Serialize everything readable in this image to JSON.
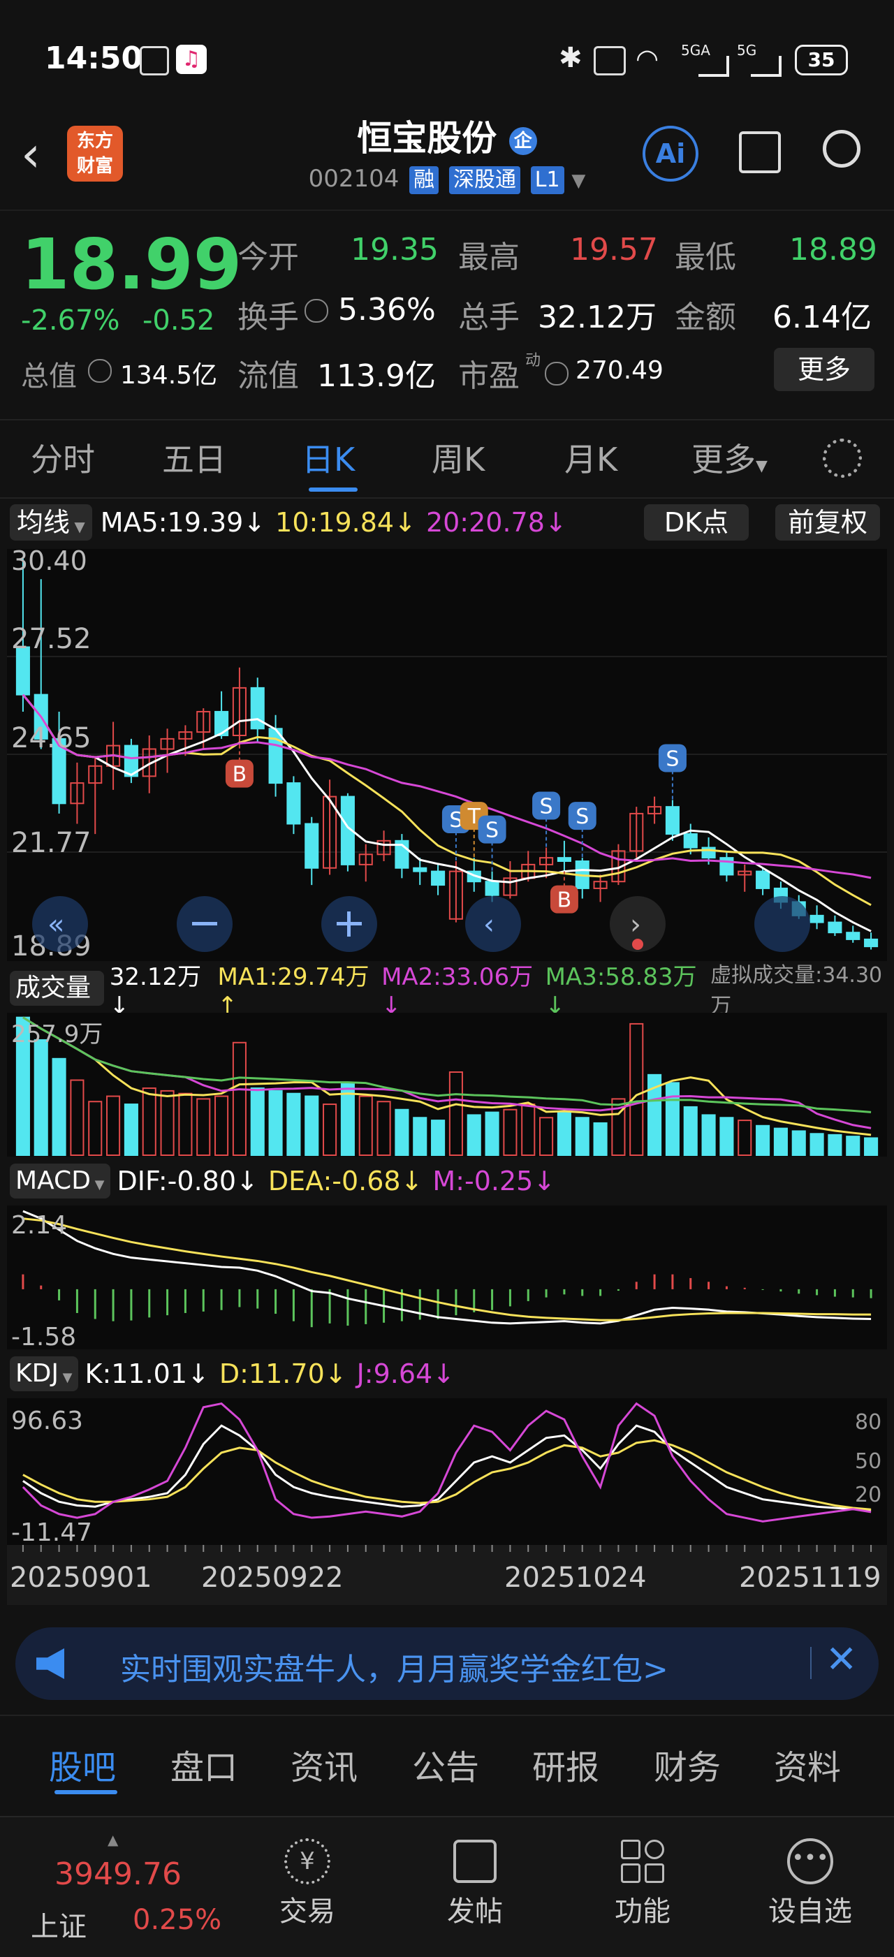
{
  "status_bar": {
    "time": "14:50",
    "battery": "35",
    "signal1": "5GA",
    "signal2": "5G"
  },
  "header": {
    "logo_line1": "东方",
    "logo_line2": "财富",
    "stock_name": "恒宝股份",
    "enterprise_badge": "企",
    "stock_code": "002104",
    "tags": [
      "融",
      "深股通",
      "L1"
    ]
  },
  "quote": {
    "price": "18.99",
    "change_pct": "-2.67%",
    "change_abs": "-0.52",
    "open_label": "今开",
    "open": "19.35",
    "high_label": "最高",
    "high": "19.57",
    "low_label": "最低",
    "low": "18.89",
    "turnover_label": "换手",
    "turnover": "5.36%",
    "volume_label": "总手",
    "volume": "32.12万",
    "amount_label": "金额",
    "amount": "6.14亿",
    "mktcap_label": "总值",
    "mktcap": "134.5亿",
    "float_label": "流值",
    "float_cap": "113.9亿",
    "pe_label": "市盈",
    "pe_sup": "动",
    "pe": "270.49",
    "more_button": "更多"
  },
  "period_tabs": [
    "分时",
    "五日",
    "日K",
    "周K",
    "月K",
    "更多"
  ],
  "active_tab": "日K",
  "ma_legend": {
    "selector": "均线",
    "ma5": "MA5:19.39↓",
    "ma10": "10:19.84↓",
    "ma20": "20:20.78↓",
    "dk_button": "DK点",
    "adjust_button": "前复权"
  },
  "kline": {
    "y_labels": [
      "30.40",
      "27.52",
      "24.65",
      "21.77",
      "18.89"
    ],
    "signals": [
      {
        "t": "B",
        "i": 12
      },
      {
        "t": "S",
        "i": 24
      },
      {
        "t": "T",
        "i": 25
      },
      {
        "t": "S",
        "i": 26
      },
      {
        "t": "S",
        "i": 29
      },
      {
        "t": "B",
        "i": 30
      },
      {
        "t": "S",
        "i": 31
      },
      {
        "t": "S",
        "i": 36
      }
    ]
  },
  "volume_legend": {
    "selector": "成交量",
    "vol": "32.12万↓",
    "ma1": "MA1:29.74万↑",
    "ma2": "MA2:33.06万↓",
    "ma3": "MA3:58.83万↓",
    "virtual": "虚拟成交量:34.30万",
    "y_label": "257.9万"
  },
  "macd_legend": {
    "selector": "MACD",
    "dif": "DIF:-0.80↓",
    "dea": "DEA:-0.68↓",
    "m": "M:-0.25↓",
    "y_top": "2.14",
    "y_bottom": "-1.58"
  },
  "kdj_legend": {
    "selector": "KDJ",
    "k": "K:11.01↓",
    "d": "D:11.70↓",
    "j": "J:9.64↓",
    "y_top": "96.63",
    "y_bottom": "-11.47",
    "right_ticks": [
      "80",
      "50",
      "20"
    ]
  },
  "dates": [
    "20250901",
    "20250922",
    "20251024",
    "20251119"
  ],
  "banner": {
    "text": "实时围观实盘牛人，月月赢奖学金红包>"
  },
  "bottom_tabs": [
    "股吧",
    "盘口",
    "资讯",
    "公告",
    "研报",
    "财务",
    "资料"
  ],
  "dock": {
    "index_value": "3949.76",
    "index_name": "上证",
    "index_change": "0.25%",
    "items": [
      "交易",
      "发帖",
      "功能",
      "设自选"
    ]
  },
  "colors": {
    "up": "#e24a4a",
    "down": "#53e6f0",
    "ma5": "#ffffff",
    "ma10": "#f7e25a",
    "ma20": "#d648d6",
    "vol_ma3": "#5cc45c"
  },
  "chart_data": [
    {
      "type": "candlestick",
      "title": "恒宝股份 日K",
      "x_start": "20250901",
      "x_end": "20251119",
      "ylim": [
        18.89,
        30.4
      ],
      "ohlc": [
        [
          27.8,
          30.4,
          25.9,
          26.4
        ],
        [
          26.4,
          29.8,
          24.8,
          25.1
        ],
        [
          25.1,
          25.9,
          22.9,
          23.2
        ],
        [
          23.2,
          24.4,
          22.6,
          23.8
        ],
        [
          23.8,
          24.6,
          22.3,
          24.3
        ],
        [
          24.3,
          25.6,
          23.6,
          24.9
        ],
        [
          24.9,
          25.1,
          23.8,
          24.0
        ],
        [
          24.0,
          25.2,
          23.5,
          24.8
        ],
        [
          24.8,
          25.4,
          24.1,
          25.1
        ],
        [
          25.1,
          25.5,
          24.6,
          25.3
        ],
        [
          25.3,
          26.0,
          24.8,
          25.9
        ],
        [
          25.9,
          26.5,
          25.1,
          25.2
        ],
        [
          25.2,
          27.2,
          24.9,
          26.6
        ],
        [
          26.6,
          26.9,
          25.0,
          25.4
        ],
        [
          25.4,
          25.8,
          23.4,
          23.8
        ],
        [
          23.8,
          24.0,
          22.3,
          22.6
        ],
        [
          22.6,
          22.8,
          20.8,
          21.3
        ],
        [
          21.3,
          23.9,
          21.1,
          23.4
        ],
        [
          23.4,
          23.5,
          21.2,
          21.4
        ],
        [
          21.4,
          22.0,
          20.9,
          21.7
        ],
        [
          21.7,
          22.4,
          21.5,
          22.1
        ],
        [
          22.1,
          22.3,
          21.0,
          21.3
        ],
        [
          21.3,
          21.6,
          20.8,
          21.2
        ],
        [
          21.2,
          21.4,
          20.5,
          20.8
        ],
        [
          19.8,
          21.5,
          19.7,
          21.2
        ],
        [
          21.2,
          21.6,
          20.6,
          20.9
        ],
        [
          20.9,
          21.2,
          20.3,
          20.5
        ],
        [
          20.5,
          21.5,
          20.4,
          21.0
        ],
        [
          21.0,
          21.8,
          20.9,
          21.4
        ],
        [
          21.4,
          21.9,
          21.0,
          21.6
        ],
        [
          21.6,
          22.1,
          21.2,
          21.5
        ],
        [
          21.5,
          21.6,
          20.4,
          20.7
        ],
        [
          20.7,
          21.1,
          20.3,
          20.9
        ],
        [
          20.9,
          22.0,
          20.8,
          21.8
        ],
        [
          21.8,
          23.1,
          21.6,
          22.9
        ],
        [
          22.9,
          23.4,
          22.6,
          23.1
        ],
        [
          23.1,
          23.3,
          22.1,
          22.3
        ],
        [
          22.3,
          22.6,
          21.7,
          21.9
        ],
        [
          21.9,
          22.2,
          21.4,
          21.6
        ],
        [
          21.6,
          21.8,
          20.9,
          21.1
        ],
        [
          21.1,
          21.4,
          20.6,
          21.2
        ],
        [
          21.2,
          21.3,
          20.5,
          20.7
        ],
        [
          20.7,
          20.9,
          20.1,
          20.3
        ],
        [
          20.3,
          20.5,
          19.8,
          19.9
        ],
        [
          19.9,
          20.2,
          19.5,
          19.7
        ],
        [
          19.7,
          19.9,
          19.3,
          19.4
        ],
        [
          19.4,
          19.6,
          19.1,
          19.2
        ],
        [
          19.2,
          19.4,
          18.9,
          18.99
        ]
      ]
    },
    {
      "type": "bar",
      "title": "成交量",
      "ylim": [
        0,
        257.9
      ],
      "values": [
        257,
        215,
        180,
        140,
        100,
        110,
        95,
        125,
        120,
        115,
        105,
        110,
        210,
        125,
        120,
        115,
        110,
        95,
        135,
        110,
        100,
        85,
        70,
        65,
        155,
        75,
        80,
        85,
        95,
        70,
        80,
        70,
        60,
        105,
        245,
        150,
        135,
        90,
        75,
        70,
        65,
        55,
        50,
        45,
        40,
        38,
        35,
        32
      ],
      "up": [
        false,
        false,
        false,
        true,
        true,
        true,
        false,
        true,
        true,
        true,
        true,
        true,
        true,
        false,
        false,
        false,
        false,
        true,
        false,
        true,
        true,
        false,
        false,
        false,
        true,
        false,
        false,
        true,
        true,
        true,
        false,
        false,
        false,
        true,
        true,
        false,
        false,
        false,
        false,
        false,
        true,
        false,
        false,
        false,
        false,
        false,
        false,
        false
      ]
    },
    {
      "type": "line",
      "title": "MACD",
      "ylim": [
        -1.58,
        2.14
      ],
      "dif": [
        2.1,
        1.9,
        1.6,
        1.3,
        1.1,
        0.95,
        0.85,
        0.8,
        0.75,
        0.7,
        0.65,
        0.6,
        0.58,
        0.5,
        0.35,
        0.15,
        -0.05,
        -0.1,
        -0.25,
        -0.35,
        -0.45,
        -0.55,
        -0.65,
        -0.75,
        -0.8,
        -0.85,
        -0.9,
        -0.92,
        -0.9,
        -0.88,
        -0.86,
        -0.9,
        -0.92,
        -0.85,
        -0.7,
        -0.55,
        -0.5,
        -0.52,
        -0.55,
        -0.6,
        -0.62,
        -0.65,
        -0.68,
        -0.72,
        -0.75,
        -0.77,
        -0.79,
        -0.8
      ],
      "dea": [
        1.9,
        1.85,
        1.75,
        1.62,
        1.5,
        1.38,
        1.27,
        1.18,
        1.1,
        1.02,
        0.95,
        0.88,
        0.82,
        0.76,
        0.68,
        0.58,
        0.46,
        0.36,
        0.24,
        0.12,
        0.0,
        -0.12,
        -0.24,
        -0.35,
        -0.45,
        -0.54,
        -0.62,
        -0.69,
        -0.74,
        -0.77,
        -0.79,
        -0.81,
        -0.83,
        -0.83,
        -0.8,
        -0.75,
        -0.7,
        -0.67,
        -0.65,
        -0.64,
        -0.64,
        -0.64,
        -0.65,
        -0.66,
        -0.67,
        -0.67,
        -0.68,
        -0.68
      ]
    },
    {
      "type": "line",
      "title": "KDJ",
      "ylim": [
        -11.47,
        96.63
      ],
      "k": [
        35,
        25,
        18,
        15,
        14,
        18,
        20,
        22,
        25,
        40,
        65,
        80,
        72,
        60,
        40,
        30,
        25,
        22,
        20,
        18,
        16,
        14,
        15,
        20,
        35,
        50,
        55,
        50,
        60,
        70,
        72,
        60,
        45,
        65,
        80,
        75,
        60,
        50,
        40,
        30,
        25,
        20,
        18,
        16,
        14,
        13,
        12,
        11.01
      ],
      "d": [
        40,
        32,
        25,
        20,
        18,
        18,
        19,
        20,
        22,
        30,
        45,
        58,
        62,
        60,
        50,
        42,
        35,
        30,
        26,
        22,
        20,
        18,
        17,
        18,
        24,
        34,
        42,
        45,
        50,
        58,
        64,
        62,
        55,
        58,
        66,
        68,
        64,
        58,
        50,
        42,
        36,
        30,
        25,
        21,
        18,
        15,
        13,
        11.7
      ],
      "j": [
        30,
        15,
        8,
        5,
        8,
        18,
        22,
        28,
        35,
        62,
        95,
        98,
        85,
        60,
        20,
        8,
        5,
        6,
        8,
        10,
        8,
        6,
        10,
        25,
        58,
        80,
        75,
        60,
        80,
        92,
        85,
        55,
        30,
        80,
        98,
        88,
        55,
        35,
        20,
        8,
        5,
        2,
        4,
        6,
        8,
        10,
        12,
        9.64
      ]
    }
  ]
}
